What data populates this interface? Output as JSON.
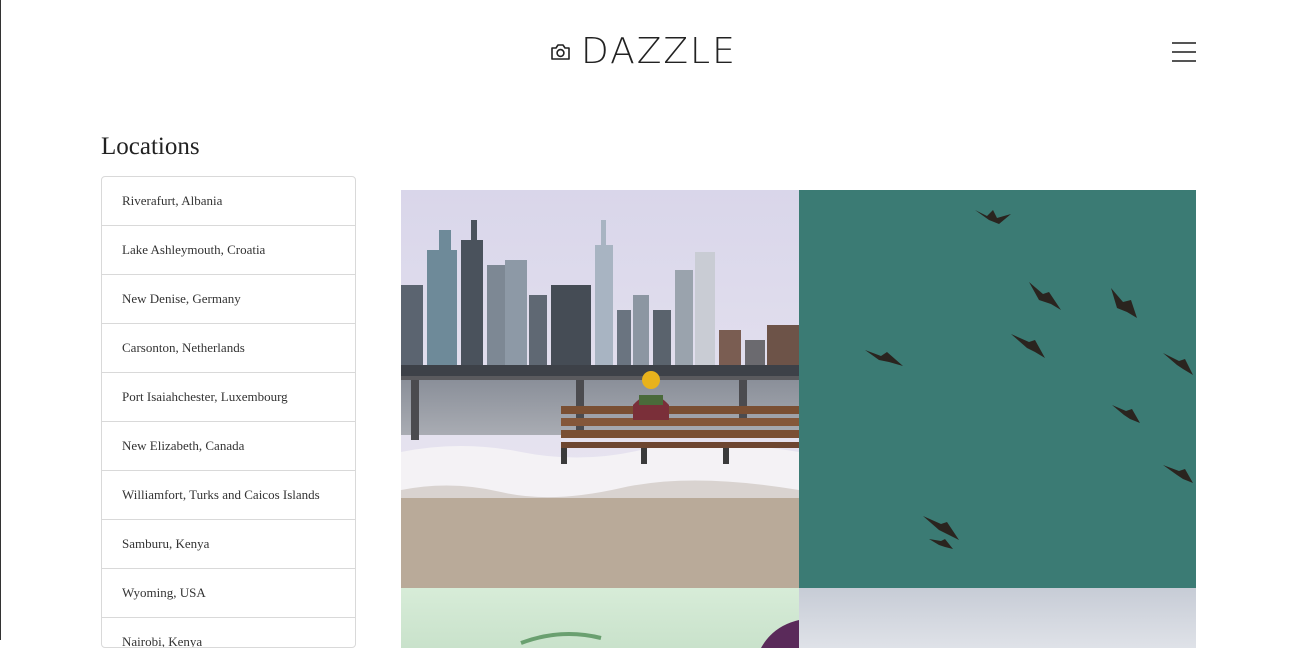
{
  "header": {
    "brand_name": "DAZZLE",
    "brand_icon": "camera-icon",
    "menu_icon": "hamburger-menu-icon"
  },
  "locations": {
    "title": "Locations",
    "items": [
      "Riverafurt, Albania",
      "Lake Ashleymouth, Croatia",
      "New Denise, Germany",
      "Carsonton, Netherlands",
      "Port Isaiahchester, Luxembourg",
      "New Elizabeth, Canada",
      "Williamfort, Turks and Caicos Islands",
      "Samburu, Kenya",
      "Wyoming, USA",
      "Nairobi, Kenya"
    ]
  },
  "gallery": {
    "photos": [
      "city-skyline-bench-photo",
      "birds-flying-photo",
      "green-photo",
      "sky-photo"
    ]
  }
}
